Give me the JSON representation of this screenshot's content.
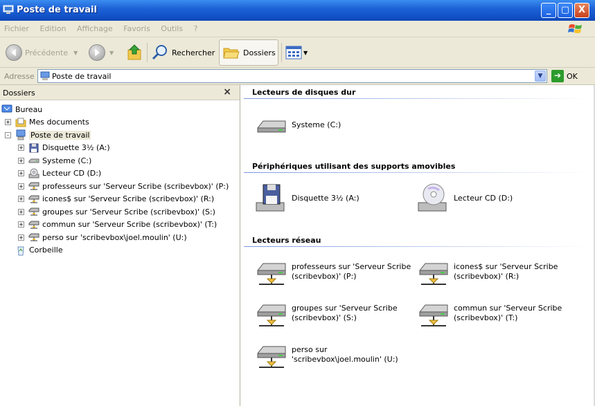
{
  "window": {
    "title": "Poste de travail",
    "btn_min": "_",
    "btn_max": "▢",
    "btn_close": "X"
  },
  "menu": [
    "Fichier",
    "Edition",
    "Affichage",
    "Favoris",
    "Outils",
    "?"
  ],
  "toolbar": {
    "back_label": "Précédente",
    "search_label": "Rechercher",
    "folders_label": "Dossiers"
  },
  "address": {
    "label": "Adresse",
    "value": "Poste de travail",
    "go_label": "OK"
  },
  "left_panel": {
    "title": "Dossiers",
    "close": "×"
  },
  "tree": [
    {
      "label": "Bureau",
      "level": 0,
      "expander": "",
      "icon": "desktop-icon"
    },
    {
      "label": "Mes documents",
      "level": 1,
      "expander": "+",
      "icon": "documents-folder-icon"
    },
    {
      "label": "Poste de travail",
      "level": 1,
      "expander": "-",
      "icon": "computer-icon",
      "selected": true
    },
    {
      "label": "Disquette 3½ (A:)",
      "level": 2,
      "expander": "+",
      "icon": "floppy-icon"
    },
    {
      "label": "Systeme (C:)",
      "level": 2,
      "expander": "+",
      "icon": "hard-drive-icon"
    },
    {
      "label": "Lecteur CD (D:)",
      "level": 2,
      "expander": "+",
      "icon": "cd-drive-icon"
    },
    {
      "label": "professeurs sur 'Serveur Scribe (scribevbox)' (P:)",
      "level": 2,
      "expander": "+",
      "icon": "network-drive-icon"
    },
    {
      "label": "icones$ sur 'Serveur Scribe (scribevbox)' (R:)",
      "level": 2,
      "expander": "+",
      "icon": "network-drive-icon"
    },
    {
      "label": "groupes sur 'Serveur Scribe (scribevbox)' (S:)",
      "level": 2,
      "expander": "+",
      "icon": "network-drive-icon"
    },
    {
      "label": "commun sur 'Serveur Scribe (scribevbox)' (T:)",
      "level": 2,
      "expander": "+",
      "icon": "network-drive-icon"
    },
    {
      "label": "perso sur 'scribevbox\\joel.moulin' (U:)",
      "level": 2,
      "expander": "+",
      "icon": "network-drive-icon"
    },
    {
      "label": "Corbeille",
      "level": 1,
      "expander": "",
      "icon": "recycle-bin-icon"
    }
  ],
  "groups": [
    {
      "title": "Lecteurs de disques dur",
      "items": [
        {
          "label": "Systeme (C:)",
          "icon": "hard-drive-icon"
        }
      ]
    },
    {
      "title": "Périphériques utilisant des supports amovibles",
      "items": [
        {
          "label": "Disquette 3½ (A:)",
          "icon": "floppy-icon"
        },
        {
          "label": "Lecteur CD (D:)",
          "icon": "cd-drive-icon"
        }
      ]
    },
    {
      "title": "Lecteurs réseau",
      "items": [
        {
          "label": "professeurs sur 'Serveur Scribe (scribevbox)' (P:)",
          "icon": "network-drive-icon"
        },
        {
          "label": "icones$ sur 'Serveur Scribe (scribevbox)' (R:)",
          "icon": "network-drive-icon"
        },
        {
          "label": "groupes sur 'Serveur Scribe (scribevbox)' (S:)",
          "icon": "network-drive-icon"
        },
        {
          "label": "commun sur 'Serveur Scribe (scribevbox)' (T:)",
          "icon": "network-drive-icon"
        },
        {
          "label": "perso sur 'scribevbox\\joel.moulin' (U:)",
          "icon": "network-drive-icon"
        }
      ]
    }
  ],
  "colors": {
    "titlebar": "#1456cc",
    "chrome": "#ece9d8",
    "selection": "#316ac5",
    "group_rule": "#7a96df"
  }
}
